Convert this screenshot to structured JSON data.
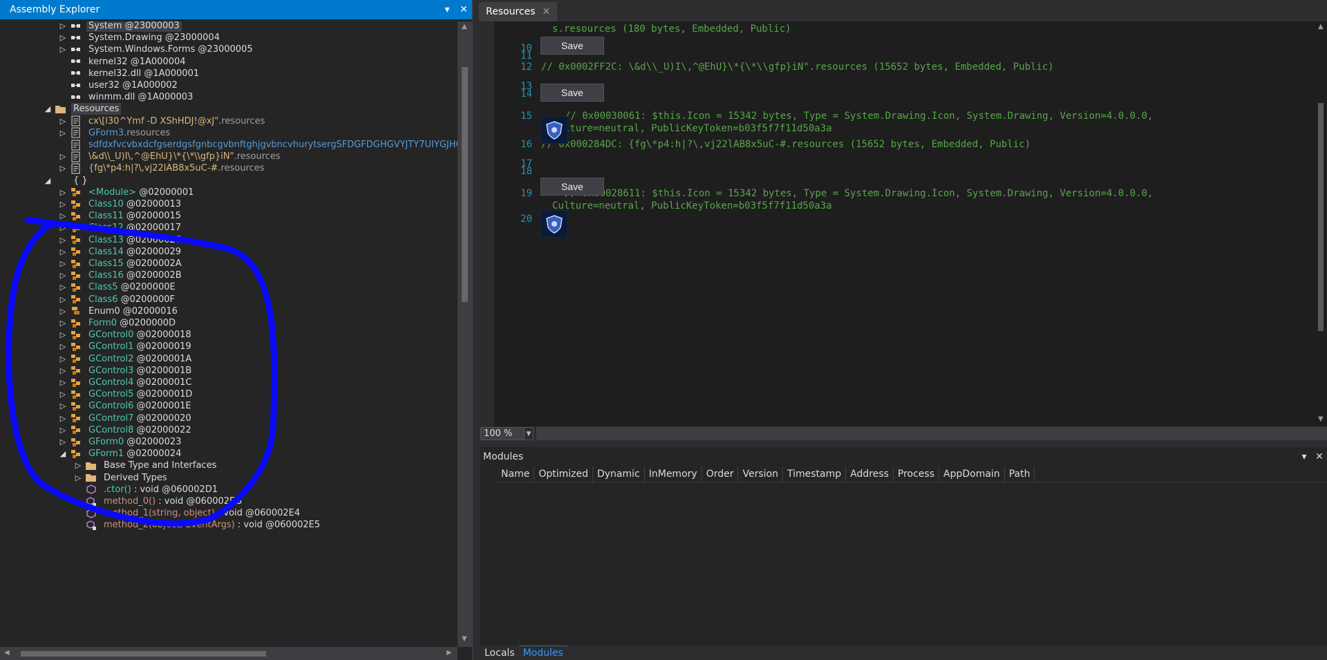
{
  "assembly_explorer": {
    "title": "Assembly Explorer",
    "tree": [
      {
        "text": "System",
        "suffix": " @23000003",
        "color": "white",
        "icon": "reference-icon",
        "selected": true,
        "expander": "▷"
      },
      {
        "text": "System.Drawing",
        "suffix": " @23000004",
        "color": "white",
        "icon": "reference-icon",
        "expander": "▷"
      },
      {
        "text": "System.Windows.Forms",
        "suffix": " @23000005",
        "color": "white",
        "icon": "reference-icon",
        "expander": "▷"
      },
      {
        "text": "kernel32",
        "suffix": " @1A000004",
        "color": "white",
        "icon": "reference-icon",
        "expander": ""
      },
      {
        "text": "kernel32.dll",
        "suffix": " @1A000001",
        "color": "white",
        "icon": "reference-icon",
        "expander": ""
      },
      {
        "text": "user32",
        "suffix": " @1A000002",
        "color": "white",
        "icon": "reference-icon",
        "expander": ""
      },
      {
        "text": "winmm.dll",
        "suffix": " @1A000003",
        "color": "white",
        "icon": "reference-icon",
        "expander": ""
      },
      {
        "text": "Resources",
        "suffix": "",
        "color": "white",
        "icon": "folder-open-icon",
        "selected": true,
        "expander": "◢",
        "indent": -1
      },
      {
        "text": "cx\\[l30^Ymf -D XShHDJ!@xJ\"",
        "suffix": ".resources",
        "color": "yellow",
        "icon": "resource-file-icon",
        "expander": "▷"
      },
      {
        "text": "GForm3",
        "suffix": ".resources",
        "color": "blue",
        "icon": "resource-file-icon",
        "expander": "▷"
      },
      {
        "text": "sdfdxfvcvbxdcfgserdgsfgnbcgvbnftghjgvbncvhurytsergSFDGFDGHGVYJTY7UIYGJHG",
        "suffix": "",
        "color": "blue",
        "icon": "resource-file-icon",
        "expander": ""
      },
      {
        "text": "\\&d\\\\_U)I\\,^@EhU}\\*{\\*\\\\gfp}iN\"",
        "suffix": ".resources",
        "color": "yellow",
        "icon": "resource-file-icon",
        "expander": "▷"
      },
      {
        "text": "{fg\\*p4:h|?\\,vj22lAB8x5uC-#",
        "suffix": ".resources",
        "color": "yellow",
        "icon": "resource-file-icon",
        "expander": "▷"
      },
      {
        "text": "{ }",
        "suffix": "",
        "color": "white",
        "icon": "",
        "expander": "◢",
        "indent": -1
      },
      {
        "text": "<Module>",
        "suffix": " @02000001",
        "color": "green",
        "icon": "class-icon",
        "expander": "▷"
      },
      {
        "text": "Class10",
        "suffix": " @02000013",
        "color": "green",
        "icon": "class-icon",
        "expander": "▷"
      },
      {
        "text": "Class11",
        "suffix": " @02000015",
        "color": "green",
        "icon": "class-icon",
        "expander": "▷"
      },
      {
        "text": "Class12",
        "suffix": " @02000017",
        "color": "green",
        "icon": "class-icon",
        "expander": "▷"
      },
      {
        "text": "Class13",
        "suffix": " @02000027",
        "color": "green",
        "icon": "class-icon",
        "expander": "▷"
      },
      {
        "text": "Class14",
        "suffix": " @02000029",
        "color": "green",
        "icon": "class-icon",
        "expander": "▷"
      },
      {
        "text": "Class15",
        "suffix": " @0200002A",
        "color": "green",
        "icon": "class-icon",
        "expander": "▷"
      },
      {
        "text": "Class16",
        "suffix": " @0200002B",
        "color": "green",
        "icon": "class-icon",
        "expander": "▷"
      },
      {
        "text": "Class5",
        "suffix": " @0200000E",
        "color": "green",
        "icon": "class-icon",
        "expander": "▷"
      },
      {
        "text": "Class6",
        "suffix": " @0200000F",
        "color": "green",
        "icon": "class-icon",
        "expander": "▷"
      },
      {
        "text": "Enum0",
        "suffix": " @02000016",
        "color": "white",
        "icon": "enum-icon",
        "expander": "▷"
      },
      {
        "text": "Form0",
        "suffix": " @0200000D",
        "color": "green",
        "icon": "class-icon",
        "expander": "▷"
      },
      {
        "text": "GControl0",
        "suffix": " @02000018",
        "color": "green",
        "icon": "class-icon",
        "expander": "▷"
      },
      {
        "text": "GControl1",
        "suffix": " @02000019",
        "color": "green",
        "icon": "class-icon",
        "expander": "▷"
      },
      {
        "text": "GControl2",
        "suffix": " @0200001A",
        "color": "green",
        "icon": "class-icon",
        "expander": "▷"
      },
      {
        "text": "GControl3",
        "suffix": " @0200001B",
        "color": "green",
        "icon": "class-icon",
        "expander": "▷"
      },
      {
        "text": "GControl4",
        "suffix": " @0200001C",
        "color": "green",
        "icon": "class-icon",
        "expander": "▷"
      },
      {
        "text": "GControl5",
        "suffix": " @0200001D",
        "color": "green",
        "icon": "class-icon",
        "expander": "▷"
      },
      {
        "text": "GControl6",
        "suffix": " @0200001E",
        "color": "green",
        "icon": "class-icon",
        "expander": "▷"
      },
      {
        "text": "GControl7",
        "suffix": " @02000020",
        "color": "green",
        "icon": "class-icon",
        "expander": "▷"
      },
      {
        "text": "GControl8",
        "suffix": " @02000022",
        "color": "green",
        "icon": "class-icon",
        "expander": "▷"
      },
      {
        "text": "GForm0",
        "suffix": " @02000023",
        "color": "green",
        "icon": "class-icon",
        "expander": "▷"
      },
      {
        "text": "GForm1",
        "suffix": " @02000024",
        "color": "green",
        "icon": "class-icon",
        "expander": "◢"
      },
      {
        "text": "Base Type and Interfaces",
        "suffix": "",
        "color": "white",
        "icon": "folder-icon",
        "expander": "▷",
        "indent": 1
      },
      {
        "text": "Derived Types",
        "suffix": "",
        "color": "white",
        "icon": "folder-icon",
        "expander": "▷",
        "indent": 1
      },
      {
        "text": ".ctor()",
        "suffix": " : void @060002D1",
        "color": "green",
        "icon": "method-icon",
        "expander": "",
        "indent": 1
      },
      {
        "text": "method_0()",
        "suffix": " : void @060002D3",
        "color": "orange",
        "icon": "private-method-icon",
        "expander": "",
        "indent": 1
      },
      {
        "text": "method_1(string, object)",
        "suffix": " : void @060002E4",
        "color": "orange",
        "icon": "method-icon",
        "expander": "",
        "indent": 1
      },
      {
        "text": "method_2(object, EventArgs)",
        "suffix": " : void @060002E5",
        "color": "orange",
        "icon": "private-method-icon",
        "expander": "",
        "indent": 1
      }
    ]
  },
  "resources_tab": {
    "label": "Resources",
    "close": "✕"
  },
  "editor": {
    "lines": [
      {
        "num": "",
        "text": "s.resources (180 bytes, Embedded, Public)"
      },
      {
        "num": "10",
        "text": ""
      },
      {
        "num": "11",
        "text": ""
      },
      {
        "num": "12",
        "text": "// 0x0002FF2C: \\&d\\\\_U)I\\,^@EhU}\\*{\\*\\\\gfp}iN\".resources (15652 bytes, Embedded, Public)"
      },
      {
        "num": "13",
        "text": ""
      },
      {
        "num": "14",
        "text": ""
      },
      {
        "num": "15",
        "text": "// 0x00030061: $this.Icon = 15342 bytes, Type = System.Drawing.Icon, System.Drawing, Version=4.0.0.0,"
      },
      {
        "num": "",
        "text": "Culture=neutral, PublicKeyToken=b03f5f7f11d50a3a"
      },
      {
        "num": "16",
        "text": "// 0x000284DC: {fg\\*p4:h|?\\,vj22lAB8x5uC-#.resources (15652 bytes, Embedded, Public)"
      },
      {
        "num": "17",
        "text": ""
      },
      {
        "num": "18",
        "text": ""
      },
      {
        "num": "19",
        "text": "// 0x00028611: $this.Icon = 15342 bytes, Type = System.Drawing.Icon, System.Drawing, Version=4.0.0.0,"
      },
      {
        "num": "",
        "text": "Culture=neutral, PublicKeyToken=b03f5f7f11d50a3a"
      },
      {
        "num": "20",
        "text": ""
      }
    ],
    "save_label": "Save",
    "zoom": "100 %"
  },
  "modules": {
    "title": "Modules",
    "columns": [
      "Name",
      "Optimized",
      "Dynamic",
      "InMemory",
      "Order",
      "Version",
      "Timestamp",
      "Address",
      "Process",
      "AppDomain",
      "Path"
    ]
  },
  "bottom_tabs": {
    "locals": "Locals",
    "modules": "Modules"
  },
  "colors": {
    "accent": "#007acc",
    "annotation": "#0a0aff"
  }
}
